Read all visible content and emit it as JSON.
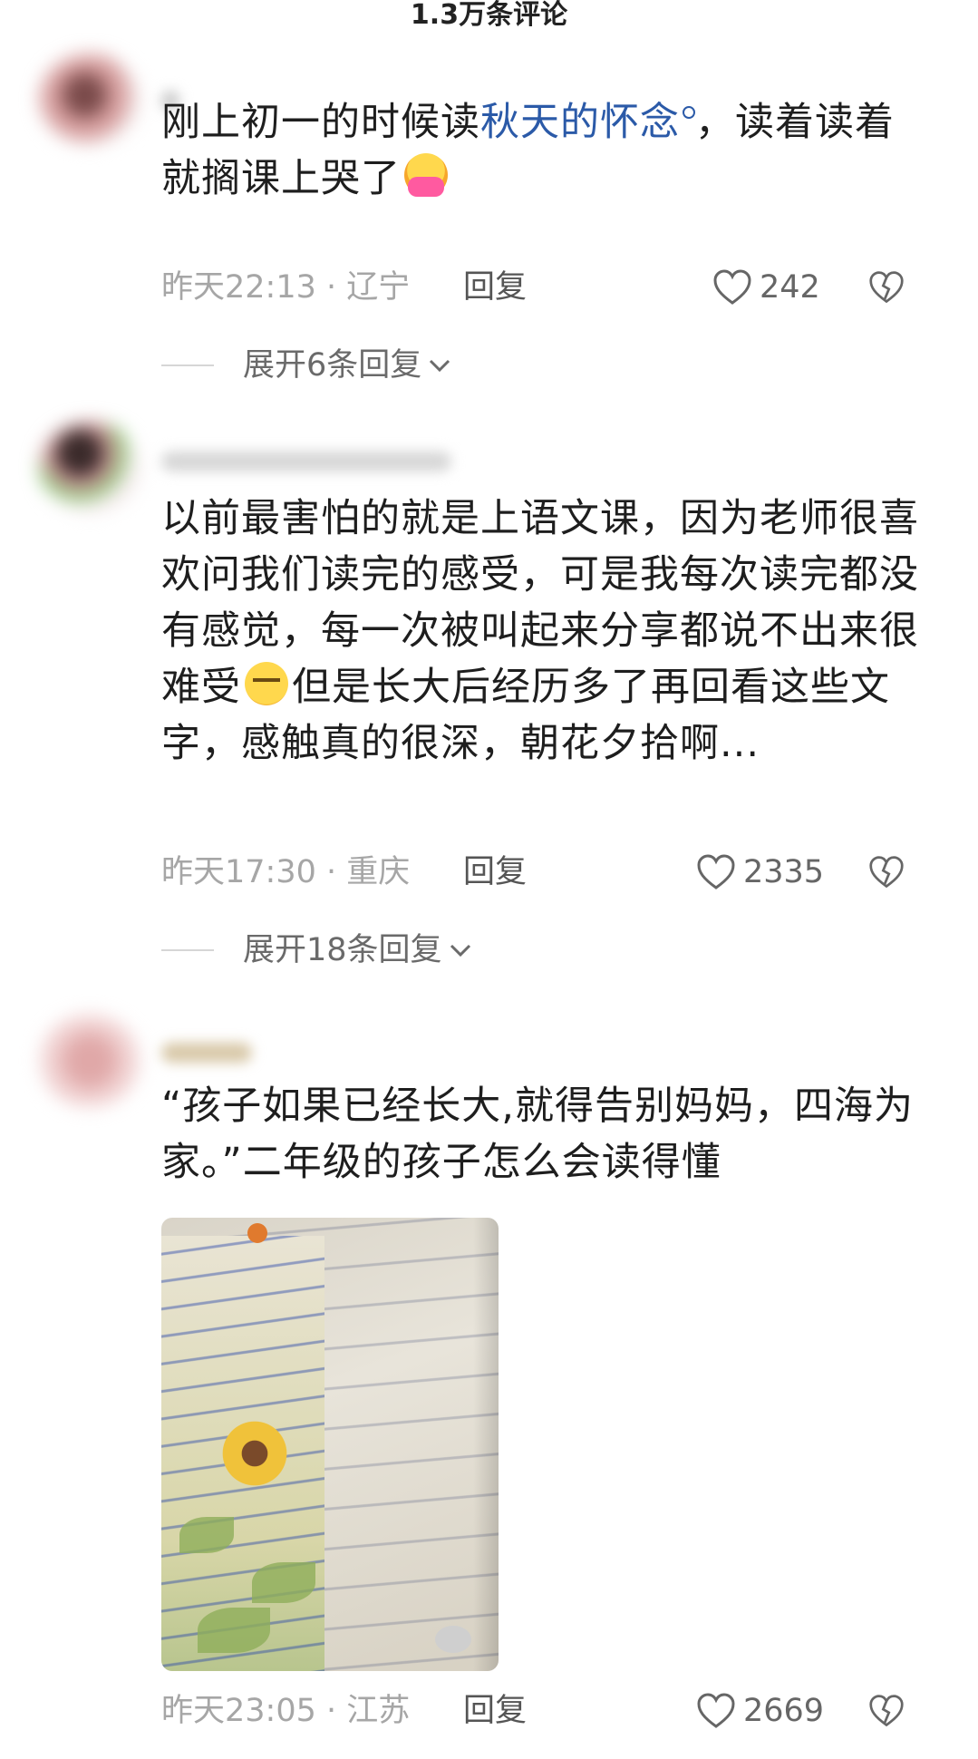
{
  "header": {
    "title": "1.3万条评论"
  },
  "comments": [
    {
      "text_before": "刚上初一的时候读",
      "link": "秋天的怀念",
      "text_after": "，读着读着就搁课上哭了",
      "emoji": "hugging-face-emoji",
      "time": "昨天22:13 · 辽宁",
      "reply": "回复",
      "likes": "242",
      "expand": "展开6条回复"
    },
    {
      "text_before": "以前最害怕的就是上语文课，因为老师很喜欢问我们读完的感受，可是我每次读完都没有感觉，每一次被叫起来分享都说不出来很难受",
      "emoji": "tired-face-emoji",
      "text_after": "但是长大后经历多了再回看这些文字，感触真的很深，朝花夕拾啊...",
      "time": "昨天17:30 · 重庆",
      "reply": "回复",
      "likes": "2335",
      "expand": "展开18条回复"
    },
    {
      "text": "“孩子如果已经长大,就得告别妈妈，四海为家。”二年级的孩子怎么会读得懂",
      "image": "textbook-page-photo",
      "time": "昨天23:05 · 江苏",
      "reply": "回复",
      "likes": "2669"
    }
  ],
  "colors": {
    "link": "#2b5aa8",
    "meta": "#a6a6a6",
    "text": "#1e1e1e"
  }
}
